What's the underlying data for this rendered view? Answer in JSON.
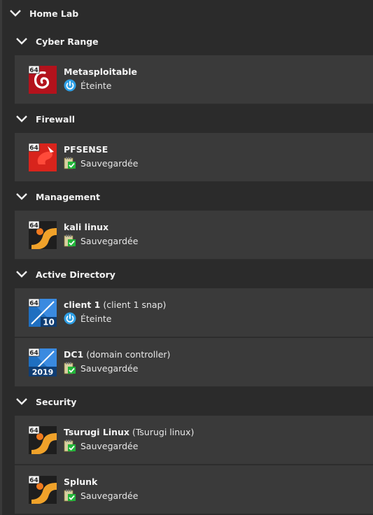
{
  "root_group": {
    "label": "Home Lab"
  },
  "groups": [
    {
      "label": "Cyber Range"
    },
    {
      "label": "Firewall"
    },
    {
      "label": "Management"
    },
    {
      "label": "Active Directory"
    },
    {
      "label": "Security"
    }
  ],
  "vms": [
    {
      "name": "Metasploitable",
      "desc": "",
      "state": "Éteinte",
      "os_badge": "64",
      "os_icon": "debian-icon",
      "state_icon": "power-icon"
    },
    {
      "name": "PFSENSE",
      "desc": "",
      "state": "Sauvegardée",
      "os_badge": "64",
      "os_icon": "freebsd-icon",
      "state_icon": "saved-state-icon"
    },
    {
      "name": "kali linux",
      "desc": "",
      "state": "Sauvegardée",
      "os_badge": "64",
      "os_icon": "linux-icon",
      "state_icon": "saved-state-icon"
    },
    {
      "name": "client 1",
      "desc": "(client 1 snap)",
      "state": "Éteinte",
      "os_badge": "64",
      "os_version": "10",
      "os_icon": "windows-10-icon",
      "state_icon": "power-icon"
    },
    {
      "name": "DC1",
      "desc": "(domain controller)",
      "state": "Sauvegardée",
      "os_badge": "64",
      "os_version": "2019",
      "os_icon": "windows-server-2019-icon",
      "state_icon": "saved-state-icon"
    },
    {
      "name": "Tsurugi Linux",
      "desc": "(Tsurugi linux)",
      "state": "Sauvegardée",
      "os_badge": "64",
      "os_icon": "linux-icon",
      "state_icon": "saved-state-icon"
    },
    {
      "name": "Splunk",
      "desc": "",
      "state": "Sauvegardée",
      "os_badge": "64",
      "os_icon": "linux-icon",
      "state_icon": "saved-state-icon"
    }
  ],
  "colors": {
    "background": "#2b2b2b",
    "row": "#3a3a3a",
    "power_blue": "#2fa0e6",
    "saved_green": "#22b53a"
  }
}
